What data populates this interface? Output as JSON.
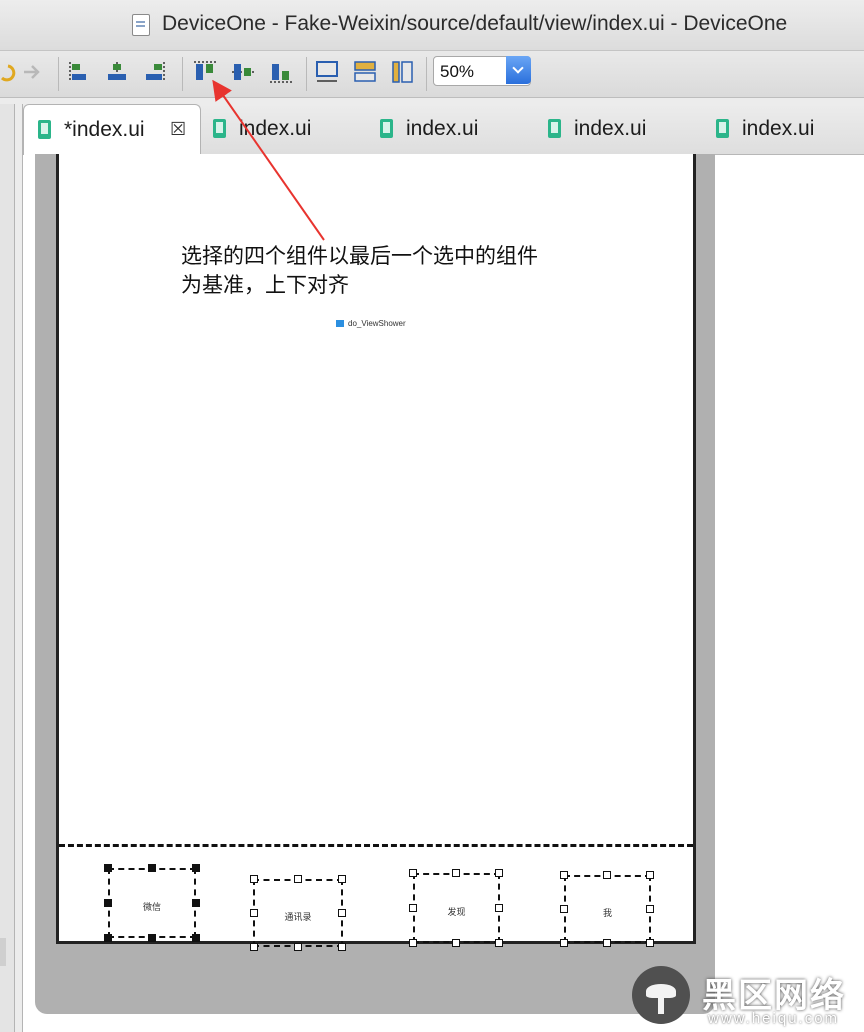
{
  "window": {
    "title": "DeviceOne - Fake-Weixin/source/default/view/index.ui - DeviceOne"
  },
  "toolbar": {
    "zoom": "50%",
    "icons": [
      "undo-icon",
      "redo-icon",
      "align-left-icon",
      "align-center-icon",
      "align-right-icon",
      "align-top-icon",
      "align-middle-icon",
      "align-bottom-icon",
      "same-width-icon",
      "same-height-icon",
      "same-size-icon"
    ]
  },
  "tabs": [
    {
      "label": "*index.ui",
      "active": true,
      "close": "☒"
    },
    {
      "label": "index.ui"
    },
    {
      "label": "index.ui"
    },
    {
      "label": "index.ui"
    },
    {
      "label": "index.ui"
    }
  ],
  "canvas": {
    "view_shower_label": "do_ViewShower",
    "bottom_items": [
      "微信",
      "通讯录",
      "发现",
      "我"
    ]
  },
  "annotation": {
    "line1": "选择的四个组件以最后一个选中的组件",
    "line2": "为基准，上下对齐",
    "arrow_color": "#e8342f"
  },
  "watermark": {
    "brand": "黑区网络",
    "url": "www.heiqu.com"
  }
}
